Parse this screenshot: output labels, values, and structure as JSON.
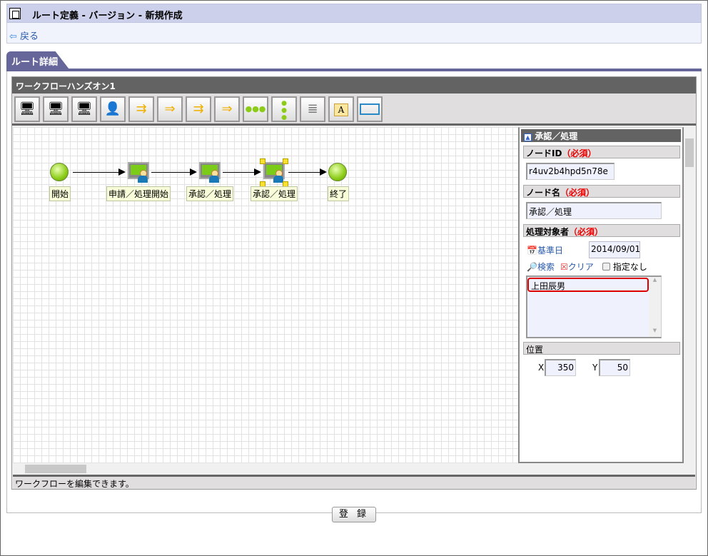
{
  "header": {
    "title": "ルート定義 - バージョン - 新規作成",
    "icon": "clipboard-icon"
  },
  "nav": {
    "back_label": "戻る"
  },
  "tab": {
    "label": "ルート詳細"
  },
  "workflow": {
    "title": "ワークフローハンズオン1",
    "toolbar": [
      "user-task",
      "group-task",
      "system-task",
      "role-task",
      "split",
      "join",
      "conditional-split",
      "conditional-join",
      "horizontal-line",
      "vertical-line",
      "database",
      "text-annotation",
      "frame"
    ],
    "nodes": [
      {
        "label": "開始",
        "type": "start"
      },
      {
        "label": "申請／処理開始",
        "type": "task"
      },
      {
        "label": "承認／処理",
        "type": "task"
      },
      {
        "label": "承認／処理",
        "type": "task",
        "selected": true
      },
      {
        "label": "終了",
        "type": "end"
      }
    ],
    "status": "ワークフローを編集できます。"
  },
  "properties": {
    "title": "承認／処理",
    "node_id_label": "ノードID",
    "required": "（必須）",
    "node_id": "r4uv2b4hpd5n78e",
    "node_name_label": "ノード名",
    "node_name": "承認／処理",
    "target_label": "処理対象者",
    "base_date_label": "基準日",
    "base_date": "2014/09/01",
    "search_label": "検索",
    "clear_label": "クリア",
    "none_label": "指定なし",
    "targets": [
      "上田辰男"
    ],
    "position_label": "位置",
    "x_label": "X",
    "x": "350",
    "y_label": "Y",
    "y": "50"
  },
  "footer": {
    "register_label": "登 録"
  }
}
